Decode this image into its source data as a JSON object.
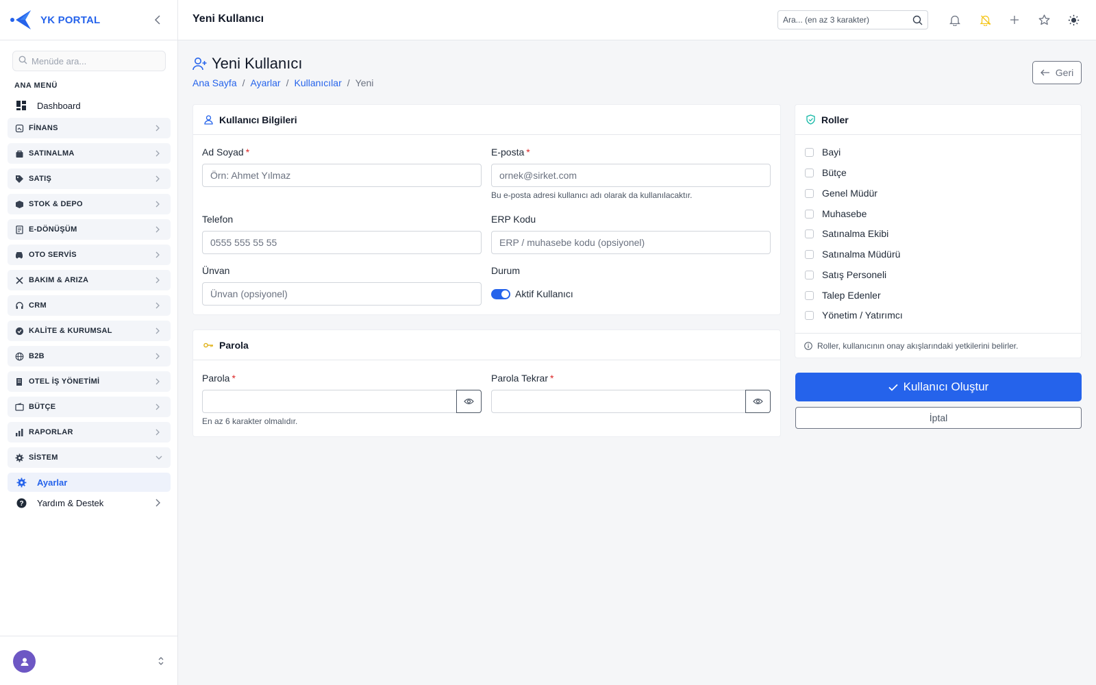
{
  "brand": {
    "name": "YK PORTAL"
  },
  "sidebar": {
    "search_placeholder": "Menüde ara...",
    "section_title": "ANA MENÜ",
    "dashboard": "Dashboard",
    "items": [
      {
        "label": "FİNANS",
        "icon": "finance-icon"
      },
      {
        "label": "SATINALMA",
        "icon": "purchase-icon"
      },
      {
        "label": "SATIŞ",
        "icon": "tag-icon"
      },
      {
        "label": "STOK & DEPO",
        "icon": "box-icon"
      },
      {
        "label": "E-DÖNÜŞÜM",
        "icon": "document-icon"
      },
      {
        "label": "OTO SERVİS",
        "icon": "car-icon"
      },
      {
        "label": "BAKIM & ARIZA",
        "icon": "tools-icon"
      },
      {
        "label": "CRM",
        "icon": "headset-icon"
      },
      {
        "label": "KALİTE & KURUMSAL",
        "icon": "quality-badge-icon"
      },
      {
        "label": "B2B",
        "icon": "globe-icon"
      },
      {
        "label": "OTEL İŞ YÖNETİMİ",
        "icon": "building-icon"
      },
      {
        "label": "BÜTÇE",
        "icon": "wallet-icon"
      },
      {
        "label": "RAPORLAR",
        "icon": "bar-chart-icon"
      },
      {
        "label": "SİSTEM",
        "icon": "gear-icon"
      }
    ],
    "active_sub": "Ayarlar",
    "help": "Yardım & Destek"
  },
  "header": {
    "title": "Yeni Kullanıcı",
    "search_placeholder": "Ara... (en az 3 karakter)"
  },
  "page": {
    "title": "Yeni Kullanıcı",
    "breadcrumb": [
      "Ana Sayfa",
      "Ayarlar",
      "Kullanıcılar",
      "Yeni"
    ],
    "back_label": "Geri"
  },
  "user_info": {
    "title": "Kullanıcı Bilgileri",
    "name_label": "Ad Soyad",
    "name_placeholder": "Örn: Ahmet Yılmaz",
    "email_label": "E-posta",
    "email_placeholder": "ornek@sirket.com",
    "email_help": "Bu e-posta adresi kullanıcı adı olarak da kullanılacaktır.",
    "phone_label": "Telefon",
    "phone_placeholder": "0555 555 55 55",
    "erp_label": "ERP Kodu",
    "erp_placeholder": "ERP / muhasebe kodu (opsiyonel)",
    "title_label": "Ünvan",
    "title_placeholder": "Ünvan (opsiyonel)",
    "status_label": "Durum",
    "status_toggle_label": "Aktif Kullanıcı",
    "required_mark": "*"
  },
  "password": {
    "title": "Parola",
    "password_label": "Parola",
    "password_help": "En az 6 karakter olmalıdır.",
    "confirm_label": "Parola Tekrar"
  },
  "roles": {
    "title": "Roller",
    "items": [
      "Bayi",
      "Bütçe",
      "Genel Müdür",
      "Muhasebe",
      "Satınalma Ekibi",
      "Satınalma Müdürü",
      "Satış Personeli",
      "Talep Edenler",
      "Yönetim / Yatırımcı"
    ],
    "info": "Roller, kullanıcının onay akışlarındaki yetkilerini belirler."
  },
  "actions": {
    "create_label": "Kullanıcı Oluştur",
    "cancel_label": "İptal"
  },
  "colors": {
    "accent": "#2563eb",
    "required": "#dc2626"
  }
}
